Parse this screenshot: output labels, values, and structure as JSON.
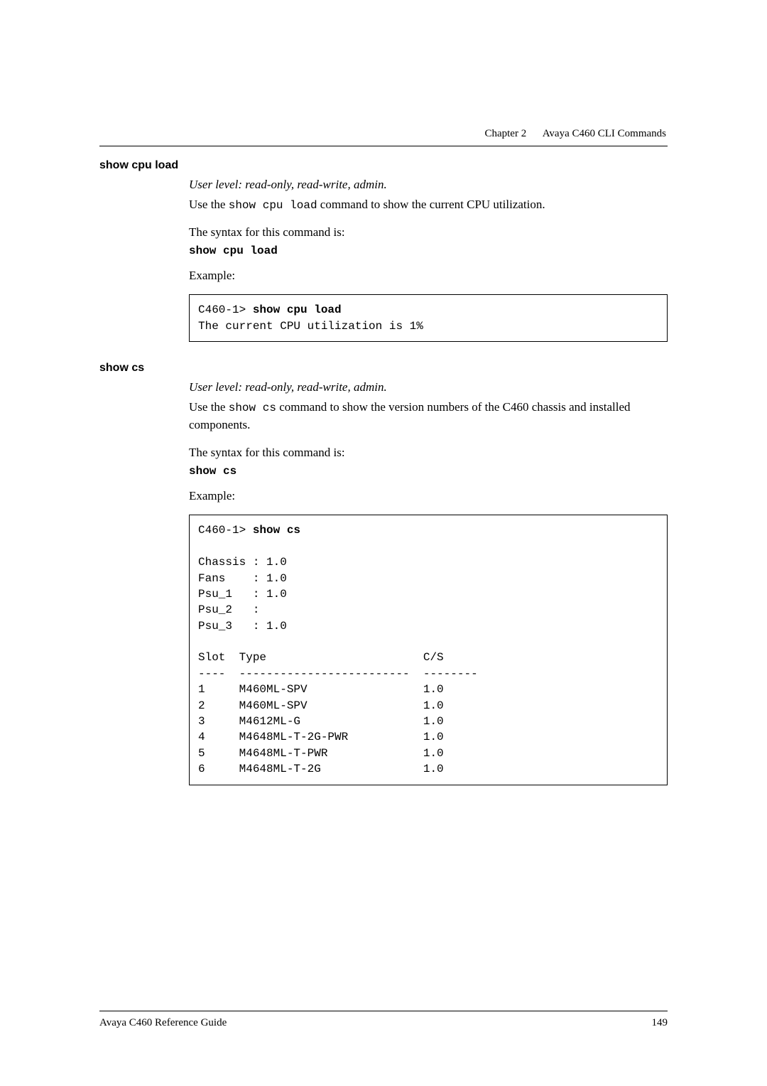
{
  "header": {
    "chapter": "Chapter 2",
    "title": "Avaya C460 CLI Commands"
  },
  "sections": [
    {
      "heading": "show cpu load",
      "userlevel": "User level: read-only, read-write, admin.",
      "intro_pre": "Use the ",
      "intro_cmd": "show cpu load",
      "intro_post": " command to show the current CPU utilization.",
      "syntax_intro": "The syntax for this command is:",
      "syntax_cmd": "show cpu load",
      "example_label": "Example:",
      "code_prompt": "C460-1> ",
      "code_command": "show cpu load",
      "code_body": "\nThe current CPU utilization is 1%"
    },
    {
      "heading": "show cs",
      "userlevel": "User level: read-only, read-write, admin.",
      "intro_pre": "Use the ",
      "intro_cmd": "show cs",
      "intro_post": " command to show the version numbers of the C460 chassis and installed components.",
      "syntax_intro": "The syntax for this command is:",
      "syntax_cmd": "show cs",
      "example_label": "Example:",
      "code_prompt": "C460-1> ",
      "code_command": "show cs",
      "code_body": "\n\nChassis : 1.0\nFans    : 1.0\nPsu_1   : 1.0\nPsu_2   :\nPsu_3   : 1.0\n\nSlot  Type                       C/S\n----  -------------------------  --------\n1     M460ML-SPV                 1.0\n2     M460ML-SPV                 1.0\n3     M4612ML-G                  1.0\n4     M4648ML-T-2G-PWR           1.0\n5     M4648ML-T-PWR              1.0\n6     M4648ML-T-2G               1.0"
    }
  ],
  "footer": {
    "left": "Avaya C460 Reference Guide",
    "right": "149"
  }
}
